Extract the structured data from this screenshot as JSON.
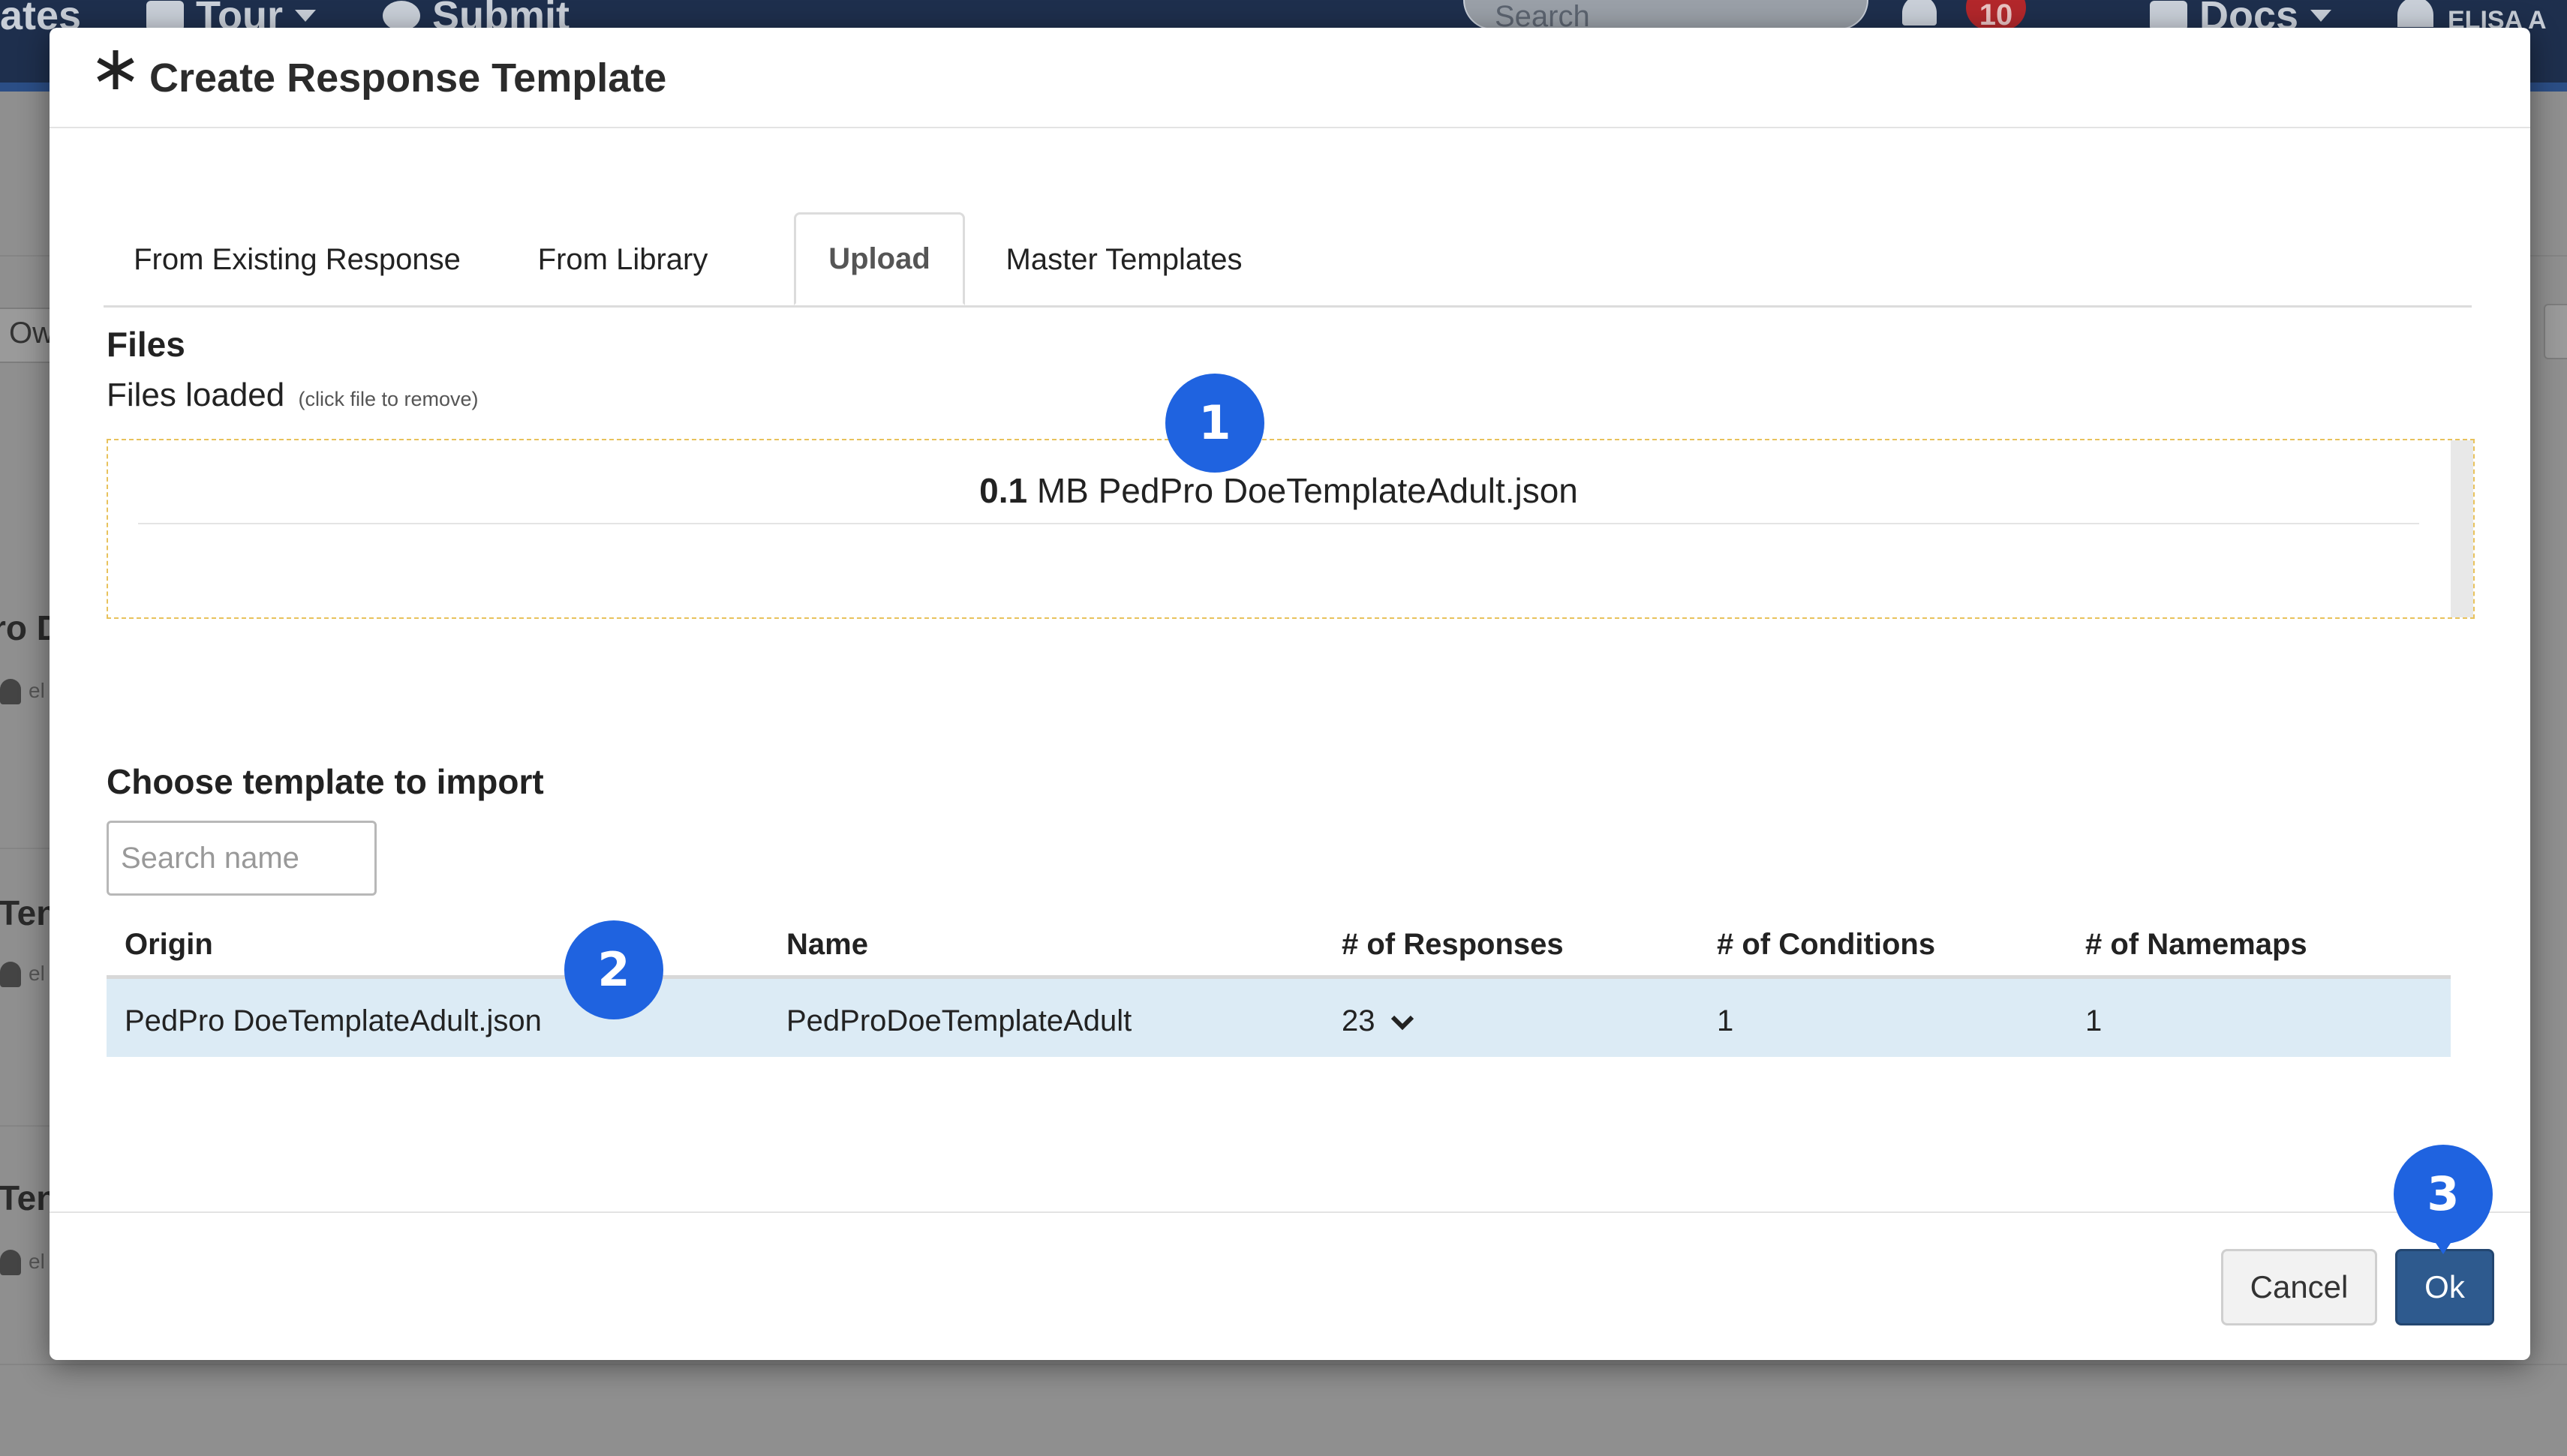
{
  "background_app": {
    "nav_frag": "ates",
    "tour": "Tour",
    "submit": "Submit",
    "search_placeholder": "Search",
    "notif_count": "10",
    "docs": "Docs",
    "user_frag": "ELISA A",
    "side_frag_1": "Ow",
    "side_frag_2": "ro D",
    "side_frag_3": "Ten",
    "side_frag_4": "Ten",
    "side_frag_5": "el",
    "side_frag_6": "el",
    "side_frag_7": "el"
  },
  "modal": {
    "title": "Create Response Template",
    "tabs": [
      {
        "label": "From Existing Response",
        "active": false
      },
      {
        "label": "From Library",
        "active": false
      },
      {
        "label": "Upload",
        "active": true
      },
      {
        "label": "Master Templates",
        "active": false
      }
    ],
    "files_heading": "Files",
    "files_loaded_label": "Files loaded",
    "files_loaded_hint": "(click file to remove)",
    "loaded_file": {
      "size_value": "0.1",
      "size_unit": "MB",
      "name": "PedPro DoeTemplateAdult.json"
    },
    "choose_heading": "Choose template to import",
    "search_placeholder": "Search name",
    "table": {
      "columns": [
        "Origin",
        "Name",
        "# of Responses",
        "# of Conditions",
        "# of Namemaps"
      ],
      "rows": [
        {
          "origin": "PedPro DoeTemplateAdult.json",
          "name": "PedProDoeTemplateAdult",
          "responses": "23",
          "conditions": "1",
          "namemaps": "1"
        }
      ]
    },
    "buttons": {
      "cancel": "Cancel",
      "ok": "Ok"
    }
  },
  "step_markers": [
    "1",
    "2",
    "3"
  ],
  "colors": {
    "marker_blue": "#1f63e0",
    "ok_button": "#2e5a8e",
    "selected_row": "#dcebf5",
    "dropzone_border": "#e8c25c"
  }
}
